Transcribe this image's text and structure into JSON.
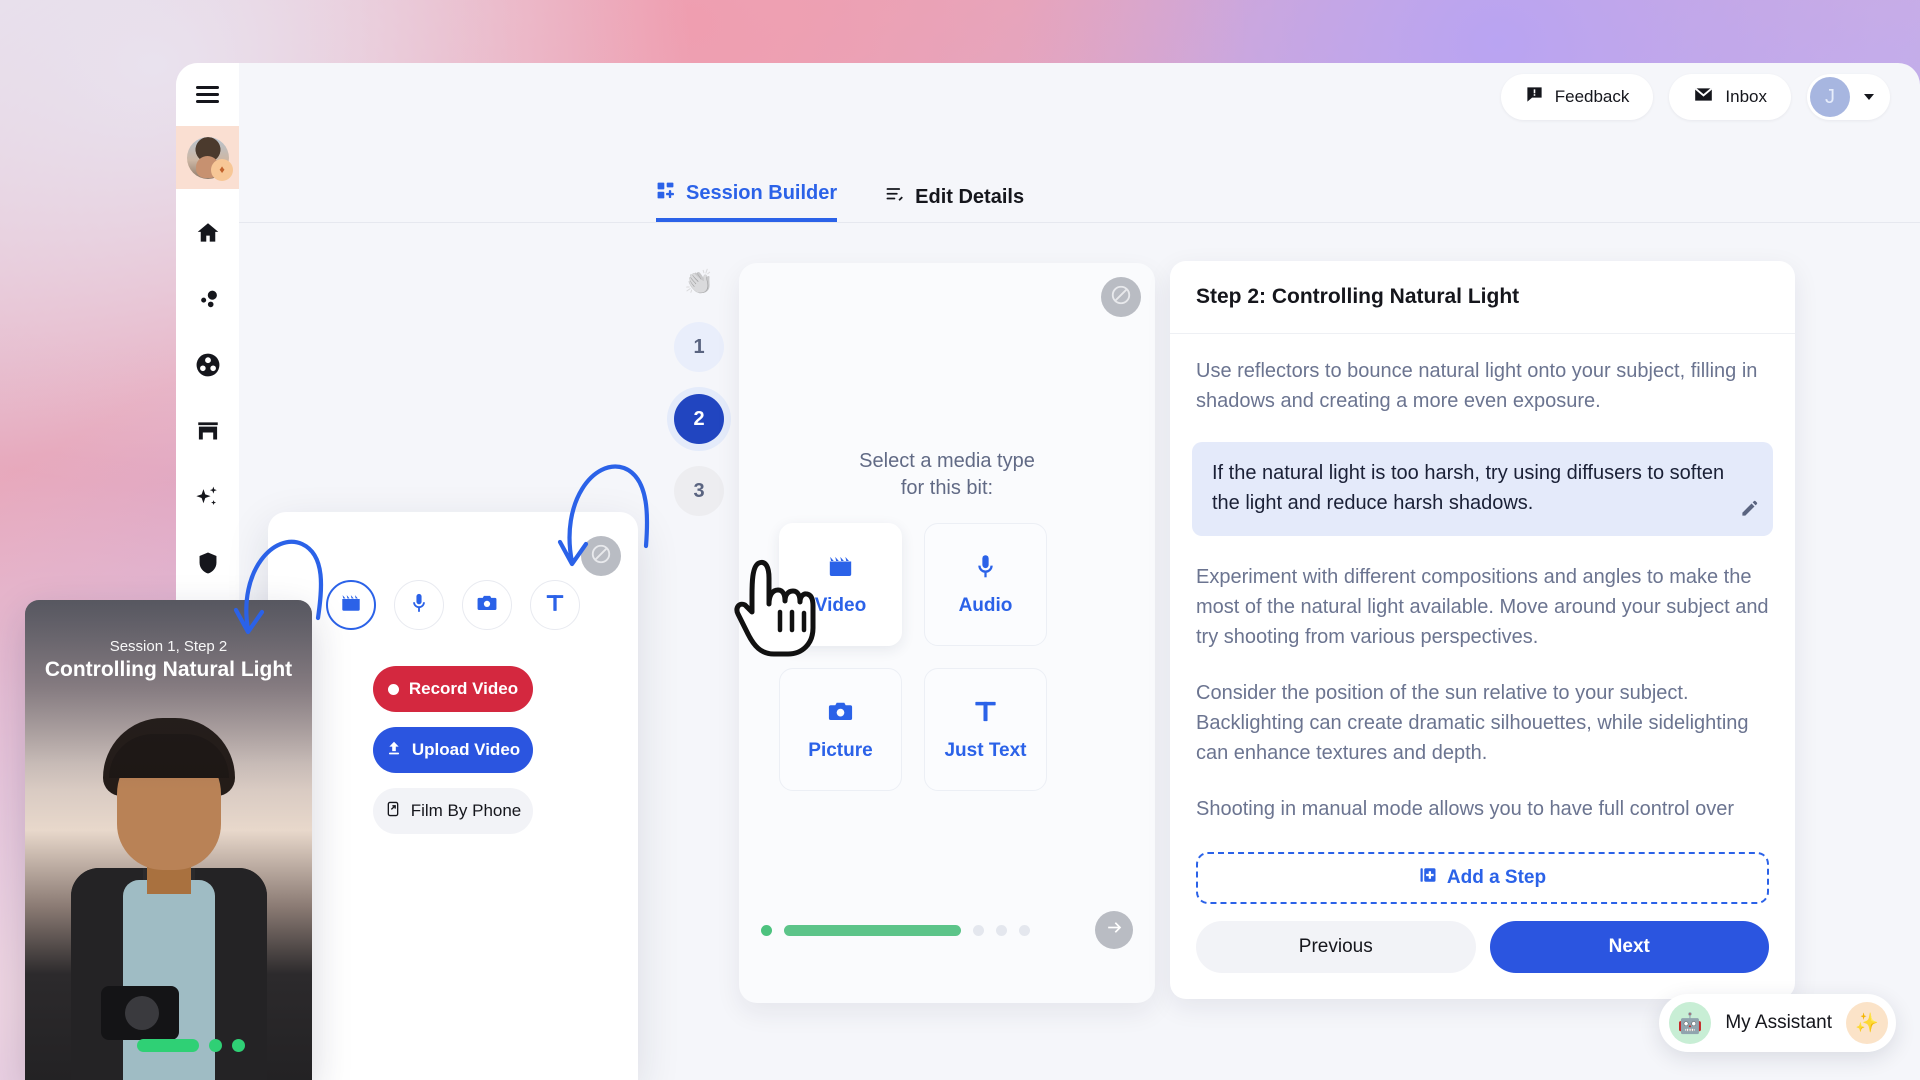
{
  "topbar": {
    "menu_icon": "hamburger-icon",
    "feedback_label": "Feedback",
    "feedback_icon": "feedback-message-icon",
    "inbox_label": "Inbox",
    "inbox_icon": "envelope-icon",
    "user_initial": "J",
    "caret_icon": "chevron-down-icon"
  },
  "sidebar": {
    "avatar_badge_icon": "diamond-badge-icon",
    "items": [
      {
        "icon": "home-icon",
        "name": "home"
      },
      {
        "icon": "nodes-icon",
        "name": "explore"
      },
      {
        "icon": "people-circle-icon",
        "name": "community"
      },
      {
        "icon": "store-icon",
        "name": "marketplace"
      },
      {
        "icon": "sparkle-icon",
        "name": "ai"
      },
      {
        "icon": "shield-icon",
        "name": "security"
      }
    ]
  },
  "tabs": [
    {
      "label": "Session Builder",
      "icon": "grid-plus-icon",
      "active": true
    },
    {
      "label": "Edit Details",
      "icon": "edit-lines-icon",
      "active": false
    }
  ],
  "steps": {
    "clap_icon": "clapping-hands-icon",
    "numbers": [
      "1",
      "2",
      "3"
    ],
    "active": "2"
  },
  "media_panel": {
    "hide_icon": "eye-off-icon",
    "prompt_line1": "Select a media type",
    "prompt_line2": "for this bit:",
    "tiles": [
      {
        "label": "Video",
        "icon": "clapperboard-icon",
        "selected": true
      },
      {
        "label": "Audio",
        "icon": "microphone-icon",
        "selected": false
      },
      {
        "label": "Picture",
        "icon": "camera-icon",
        "selected": false
      },
      {
        "label": "Just Text",
        "icon": "text-t-icon",
        "selected": false
      }
    ],
    "progress": {
      "filled_dots": 1,
      "empty_dots": 3,
      "bar_percent": 100
    },
    "next_icon": "arrow-right-icon"
  },
  "step_card": {
    "title": "Step 2: Controlling Natural Light",
    "paragraphs": [
      {
        "text": "Use reflectors to bounce natural light onto your subject, filling in shadows and creating a more even exposure.",
        "highlight": false
      },
      {
        "text": "If the natural light is too harsh, try using diffusers to soften the light and reduce harsh shadows.",
        "highlight": true
      },
      {
        "text": "Experiment with different compositions and angles to make the most of the natural light available. Move around your subject and try shooting from various perspectives.",
        "highlight": false
      },
      {
        "text": "Consider the position of the sun relative to your subject. Backlighting can create dramatic silhouettes, while sidelighting can enhance textures and depth.",
        "highlight": false
      },
      {
        "text": "Shooting in manual mode allows you to have full control over",
        "highlight": false
      }
    ],
    "edit_icon": "pencil-icon",
    "add_step_label": "Add a Step",
    "add_step_icon": "add-page-icon",
    "previous_label": "Previous",
    "next_label": "Next"
  },
  "record_card": {
    "hide_icon": "eye-off-icon",
    "mode_icons": [
      {
        "icon": "clapperboard-icon",
        "name": "video",
        "active": true
      },
      {
        "icon": "microphone-icon",
        "name": "audio",
        "active": false
      },
      {
        "icon": "camera-icon",
        "name": "picture",
        "active": false
      },
      {
        "icon": "text-t-icon",
        "name": "text",
        "active": false
      }
    ],
    "actions": [
      {
        "label": "Record Video",
        "icon": "record-dot-icon",
        "style": "red"
      },
      {
        "label": "Upload Video",
        "icon": "upload-icon",
        "style": "blue"
      },
      {
        "label": "Film By Phone",
        "icon": "phone-share-icon",
        "style": "grey"
      }
    ]
  },
  "preview": {
    "session_label": "Session 1, Step 2",
    "title": "Controlling Natural Light",
    "progress": {
      "bar_percent": 100,
      "dots": 2
    }
  },
  "assistant": {
    "label": "My Assistant",
    "bot_icon": "robot-icon",
    "spark_icon": "sparkle-icon"
  },
  "colors": {
    "accent_blue": "#2b62e8",
    "deep_blue": "#2145c0",
    "record_red": "#d4283f",
    "progress_green": "#5cc489",
    "highlight_bg": "#e4eafa"
  }
}
